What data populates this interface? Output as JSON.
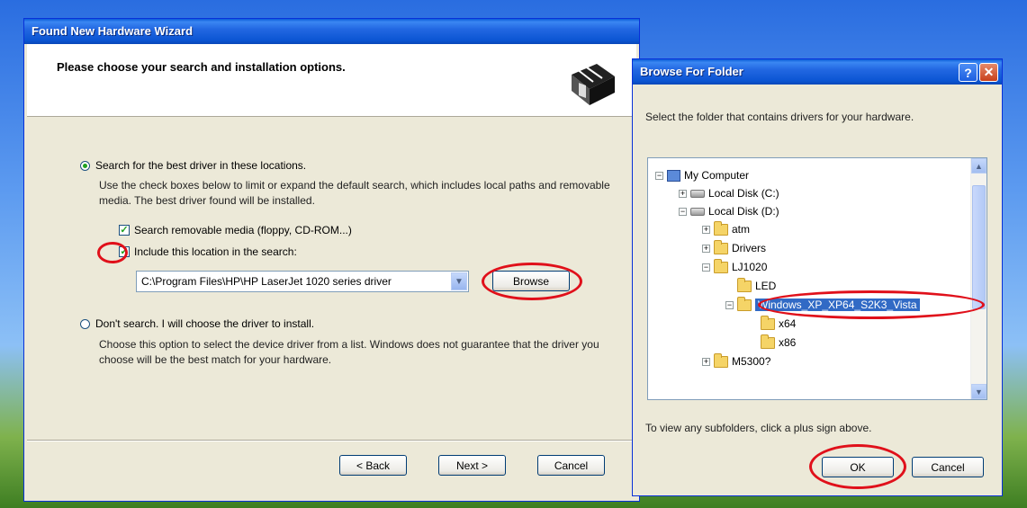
{
  "wizard": {
    "title": "Found New Hardware Wizard",
    "header": "Please choose your search and installation options.",
    "option_search": "Search for the best driver in these locations.",
    "search_desc": "Use the check boxes below to limit or expand the default search, which includes local paths and removable media. The best driver found will be installed.",
    "check_removable": "Search removable media (floppy, CD-ROM...)",
    "check_include": "Include this location in the search:",
    "path_value": "C:\\Program Files\\HP\\HP LaserJet 1020 series driver",
    "browse": "Browse",
    "option_dont": "Don't search. I will choose the driver to install.",
    "dont_desc": "Choose this option to select the device driver from a list. Windows does not guarantee that the driver you choose will be the best match for your hardware.",
    "back": "< Back",
    "next": "Next >",
    "cancel": "Cancel"
  },
  "browse_dialog": {
    "title": "Browse For Folder",
    "help": "?",
    "close": "✕",
    "instruction": "Select the folder that contains drivers for your hardware.",
    "tree": [
      {
        "label": "My Computer",
        "icon": "computer-icon",
        "expander": "−"
      },
      {
        "label": "Local Disk (C:)",
        "icon": "drive-icon",
        "expander": "+"
      },
      {
        "label": "Local Disk (D:)",
        "icon": "drive-icon",
        "expander": "−"
      },
      {
        "label": "atm",
        "icon": "folder-icon",
        "expander": "+"
      },
      {
        "label": "Drivers",
        "icon": "folder-icon",
        "expander": "+"
      },
      {
        "label": "LJ1020",
        "icon": "folder-icon",
        "expander": "−"
      },
      {
        "label": "LED",
        "icon": "folder-icon",
        "expander": ""
      },
      {
        "label": "Windows_XP_XP64_S2K3_Vista",
        "icon": "folder-icon",
        "expander": "−",
        "selected": true
      },
      {
        "label": "x64",
        "icon": "folder-icon",
        "expander": ""
      },
      {
        "label": "x86",
        "icon": "folder-icon",
        "expander": ""
      },
      {
        "label": "M5300?",
        "icon": "folder-icon",
        "expander": "+"
      }
    ],
    "hint": "To view any subfolders, click a plus sign above.",
    "ok": "OK",
    "cancel": "Cancel"
  },
  "colors": {
    "title_bar": "#0a5bd8",
    "dialog_bg": "#ece9d8",
    "annotation_red": "#e0101a",
    "selection": "#316ac5"
  }
}
